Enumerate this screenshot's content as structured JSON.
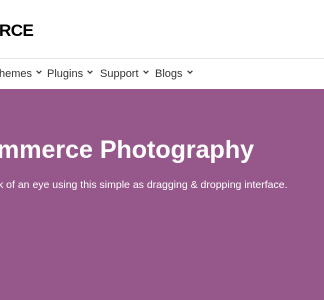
{
  "header": {
    "logo_text": "RCE"
  },
  "nav": {
    "items": [
      {
        "label": "hemes",
        "icon": "chevron-down-icon"
      },
      {
        "label": "Plugins",
        "icon": "chevron-down-icon"
      },
      {
        "label": "Support",
        "icon": "chevron-down-icon"
      },
      {
        "label": "Blogs",
        "icon": "chevron-down-icon"
      }
    ]
  },
  "hero": {
    "title": "mmerce Photography",
    "subtitle": "k of an eye using this simple as dragging & dropping interface.",
    "background_color": "#96588a",
    "text_color": "#ffffff"
  }
}
